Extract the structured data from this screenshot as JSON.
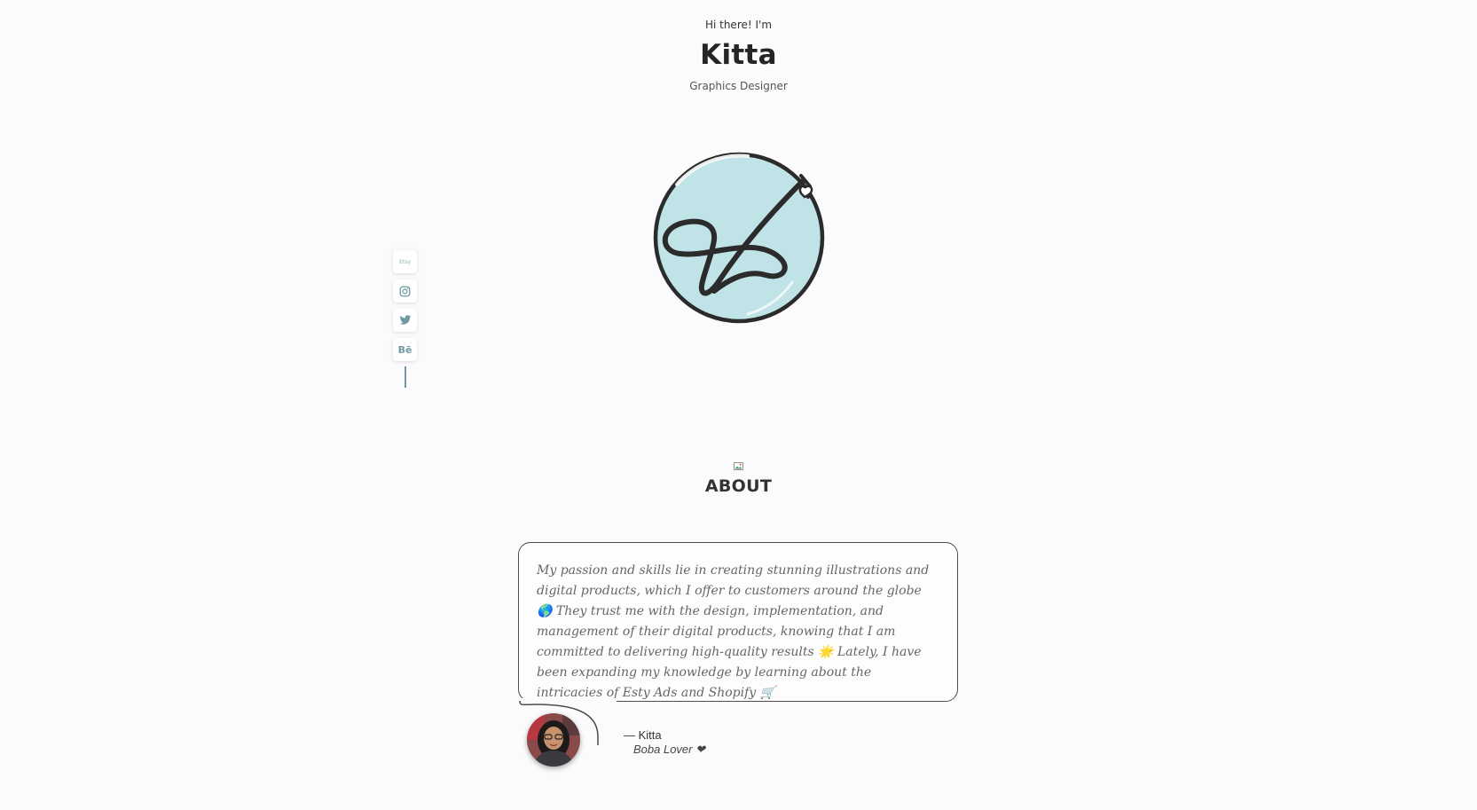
{
  "hero": {
    "greeting": "Hi there! I'm",
    "name": "Kitta",
    "role": "Graphics Designer"
  },
  "logo": {
    "icon": "k-monogram-logo",
    "fill_color": "#bfe3e6",
    "stroke_color": "#2b2b2b"
  },
  "social": {
    "accent_color": "#6f9aa4",
    "items": [
      {
        "name": "etsy",
        "label": "Etsy"
      },
      {
        "name": "instagram",
        "label": ""
      },
      {
        "name": "twitter",
        "label": ""
      },
      {
        "name": "behance",
        "label": "Bē"
      }
    ]
  },
  "about": {
    "title": "ABOUT",
    "quote": "My passion and skills lie in creating stunning illustrations and digital products, which I offer to customers around the globe 🌎 They trust me with the design, implementation, and management of their digital products, knowing that I am committed to delivering high-quality results 🌟 Lately, I have been expanding my knowledge by learning about the intricacies of Esty Ads and Shopify 🛒",
    "author": "— Kitta",
    "tagline": "Boba Lover ❤"
  }
}
